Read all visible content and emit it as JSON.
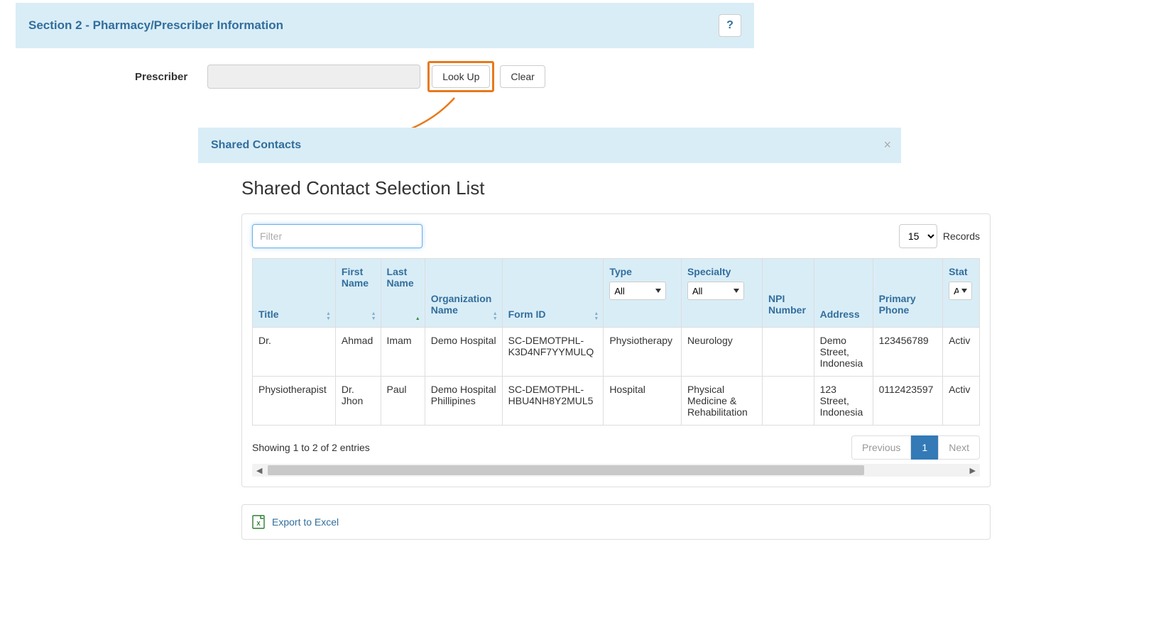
{
  "section": {
    "title": "Section 2 - Pharmacy/Prescriber Information",
    "help": "?"
  },
  "prescriber": {
    "label": "Prescriber",
    "lookup": "Look Up",
    "clear": "Clear"
  },
  "modal": {
    "header": "Shared Contacts",
    "title": "Shared Contact Selection List"
  },
  "toolbar": {
    "filter_placeholder": "Filter",
    "records_value": "15",
    "records_label": "Records"
  },
  "columns": {
    "title": "Title",
    "first_name": "First Name",
    "last_name": "Last Name",
    "org": "Organization Name",
    "form_id": "Form ID",
    "type": "Type",
    "specialty": "Specialty",
    "npi": "NPI Number",
    "address": "Address",
    "phone": "Primary Phone",
    "status": "Stat"
  },
  "filters": {
    "type": "All",
    "specialty": "All",
    "status": "All"
  },
  "rows": [
    {
      "title": "Dr.",
      "first_name": "Ahmad",
      "last_name": "Imam",
      "org": "Demo Hospital",
      "form_id": "SC-DEMOTPHL-K3D4NF7YYMULQ",
      "type": "Physiotherapy",
      "specialty": "Neurology",
      "npi": "",
      "address": "Demo Street, Indonesia",
      "phone": "123456789",
      "status": "Activ"
    },
    {
      "title": "Physiotherapist",
      "first_name": "Dr. Jhon",
      "last_name": "Paul",
      "org": "Demo Hospital Phillipines",
      "form_id": "SC-DEMOTPHL-HBU4NH8Y2MUL5",
      "type": "Hospital",
      "specialty": "Physical Medicine & Rehabilitation",
      "npi": "",
      "address": "123 Street, Indonesia",
      "phone": "0112423597",
      "status": "Activ"
    }
  ],
  "footer": {
    "info": "Showing 1 to 2 of 2 entries",
    "previous": "Previous",
    "page1": "1",
    "next": "Next"
  },
  "export": {
    "label": "Export to Excel"
  }
}
